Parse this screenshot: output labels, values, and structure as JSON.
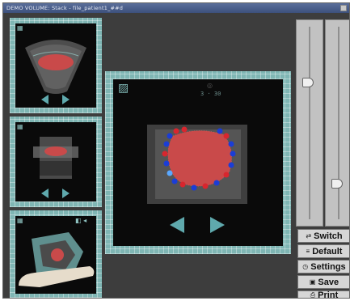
{
  "window": {
    "title": "DEMO VOLUME: Stack - file_patient1_##d"
  },
  "viewer": {
    "readout": "3 · 30"
  },
  "buttons": {
    "switch": "Switch",
    "default": "Default",
    "settings": "Settings",
    "save": "Save",
    "print": "Print"
  },
  "sliders": [
    {
      "name": "left-slider",
      "level_fraction": 0.28
    },
    {
      "name": "right-slider",
      "level_fraction": 0.83
    }
  ],
  "colors": {
    "frame": "#7fb6b4",
    "screen": "#0a0a0a",
    "tissue": "#c94a4a",
    "marker_red": "#d8262e",
    "marker_blue": "#1b3dd6",
    "arrows": "#5fa9ad"
  },
  "icons": [
    "grid-icon",
    "prev-arrow-icon",
    "next-arrow-icon",
    "switch-icon",
    "default-icon",
    "settings-icon",
    "save-icon",
    "print-icon"
  ]
}
